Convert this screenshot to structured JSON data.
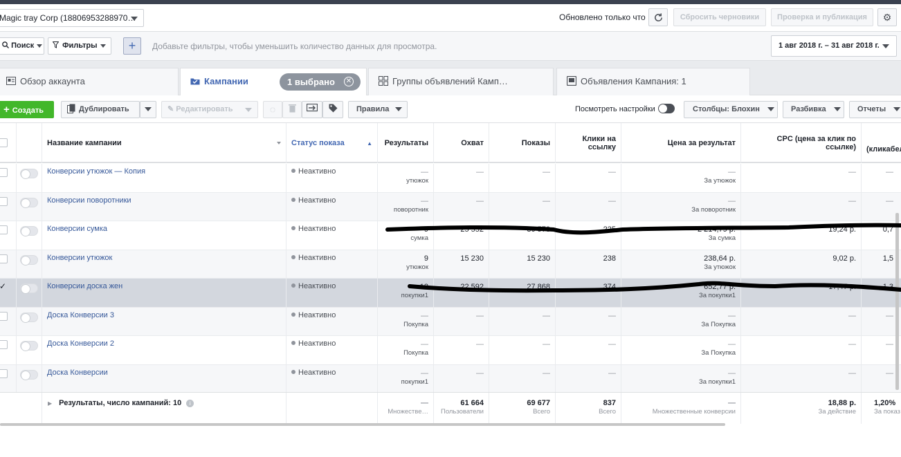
{
  "account": {
    "name": "Magic tray Corp (18806953288970…"
  },
  "header": {
    "updated": "Обновлено только что",
    "discard_label": "Сбросить черновики",
    "review_label": "Проверка и публикация"
  },
  "filters": {
    "search_label": "Поиск",
    "filters_label": "Фильтры",
    "add_icon": "plus-icon",
    "hint": "Добавьте фильтры, чтобы уменьшить количество данных для просмотра.",
    "date_range": "1 авг 2018 г. – 31 авг 2018 г."
  },
  "tabs": [
    {
      "label": "Обзор аккаунта",
      "icon": "account-overview-icon"
    },
    {
      "label": "Кампании",
      "icon": "campaigns-folder-icon"
    },
    {
      "label": "Группы объявлений Камп…",
      "icon": "adsets-grid-icon"
    },
    {
      "label": "Объявления Кампания: 1",
      "icon": "ads-icon"
    }
  ],
  "selected_chip": {
    "label": "1 выбрано"
  },
  "toolbar": {
    "create_label": "Создать",
    "duplicate_label": "Дублировать",
    "edit_label": "Редактировать",
    "rules_label": "Правила",
    "view_settings": "Посмотреть настройки",
    "columns_label": "Столбцы: Блохин",
    "breakdown_label": "Разбивка",
    "reports_label": "Отчеты"
  },
  "columns": {
    "name": "Название кампании",
    "status": "Статус показа",
    "results": "Результаты",
    "reach": "Охват",
    "impressions": "Показы",
    "link_clicks": "Клики на ссылку",
    "cost_per_result": "Цена за результат",
    "cpc": "CPC (цена за клик по ссылке)",
    "ctr": "(кликабел"
  },
  "rows": [
    {
      "name": "Конверсии утюжок — Копия",
      "status": "Неактивно",
      "results": "—",
      "results_sub": "утюжок",
      "reach": "—",
      "impressions": "—",
      "clicks": "—",
      "cost": "—",
      "cost_sub": "За утюжок",
      "cpc": "—",
      "ctr": "—",
      "selected": false
    },
    {
      "name": "Конверсии поворотники",
      "status": "Неактивно",
      "results": "—",
      "results_sub": "поворотник",
      "reach": "—",
      "impressions": "—",
      "clicks": "—",
      "cost": "—",
      "cost_sub": "За поворотник",
      "cpc": "—",
      "ctr": "—",
      "selected": false
    },
    {
      "name": "Конверсии сумка",
      "status": "Неактивно",
      "results": "9",
      "results_sub": "сумка",
      "reach": "25 552",
      "impressions": "30 570",
      "clicks": "225",
      "cost": "2 214,79 р.",
      "cost_sub": "За сумка",
      "cpc": "19,24 р.",
      "ctr": "0,7",
      "selected": false
    },
    {
      "name": "Конверсии утюжок",
      "status": "Неактивно",
      "results": "9",
      "results_sub": "утюжок",
      "reach": "15 230",
      "impressions": "15 230",
      "clicks": "238",
      "cost": "238,64 р.",
      "cost_sub": "За утюжок",
      "cpc": "9,02 р.",
      "ctr": "1,5",
      "selected": false
    },
    {
      "name": "Конверсии доска жен",
      "status": "Неактивно",
      "results": "12",
      "results_sub": "покупки1",
      "reach": "22 592",
      "impressions": "27 868",
      "clicks": "374",
      "cost": "652,77 р.",
      "cost_sub": "За покупки1",
      "cpc": "17,47 р.",
      "ctr": "1,3",
      "selected": true
    },
    {
      "name": "Доска Конверсии 3",
      "status": "Неактивно",
      "results": "—",
      "results_sub": "Покупка",
      "reach": "—",
      "impressions": "—",
      "clicks": "—",
      "cost": "—",
      "cost_sub": "За Покупка",
      "cpc": "—",
      "ctr": "—",
      "selected": false
    },
    {
      "name": "Доска Конверсии 2",
      "status": "Неактивно",
      "results": "—",
      "results_sub": "Покупка",
      "reach": "—",
      "impressions": "—",
      "clicks": "—",
      "cost": "—",
      "cost_sub": "За Покупка",
      "cpc": "—",
      "ctr": "—",
      "selected": false
    },
    {
      "name": "Доска Конверсии",
      "status": "Неактивно",
      "results": "—",
      "results_sub": "покупки1",
      "reach": "—",
      "impressions": "—",
      "clicks": "—",
      "cost": "—",
      "cost_sub": "За покупки1",
      "cpc": "—",
      "ctr": "—",
      "selected": false
    }
  ],
  "totals": {
    "label": "Результаты, число кампаний: 10",
    "results": "—",
    "results_sub": "Множестве…",
    "reach": "61 664",
    "reach_sub": "Пользователи",
    "impressions": "69 677",
    "impressions_sub": "Всего",
    "clicks": "837",
    "clicks_sub": "Всего",
    "cost": "—",
    "cost_sub": "Множественные конверсии",
    "cpc": "18,88 р.",
    "cpc_sub": "За действие",
    "ctr": "1,20%",
    "ctr_sub": "За показ"
  },
  "colors": {
    "accent": "#4267b2",
    "create": "#42b72a",
    "link": "#365899"
  }
}
